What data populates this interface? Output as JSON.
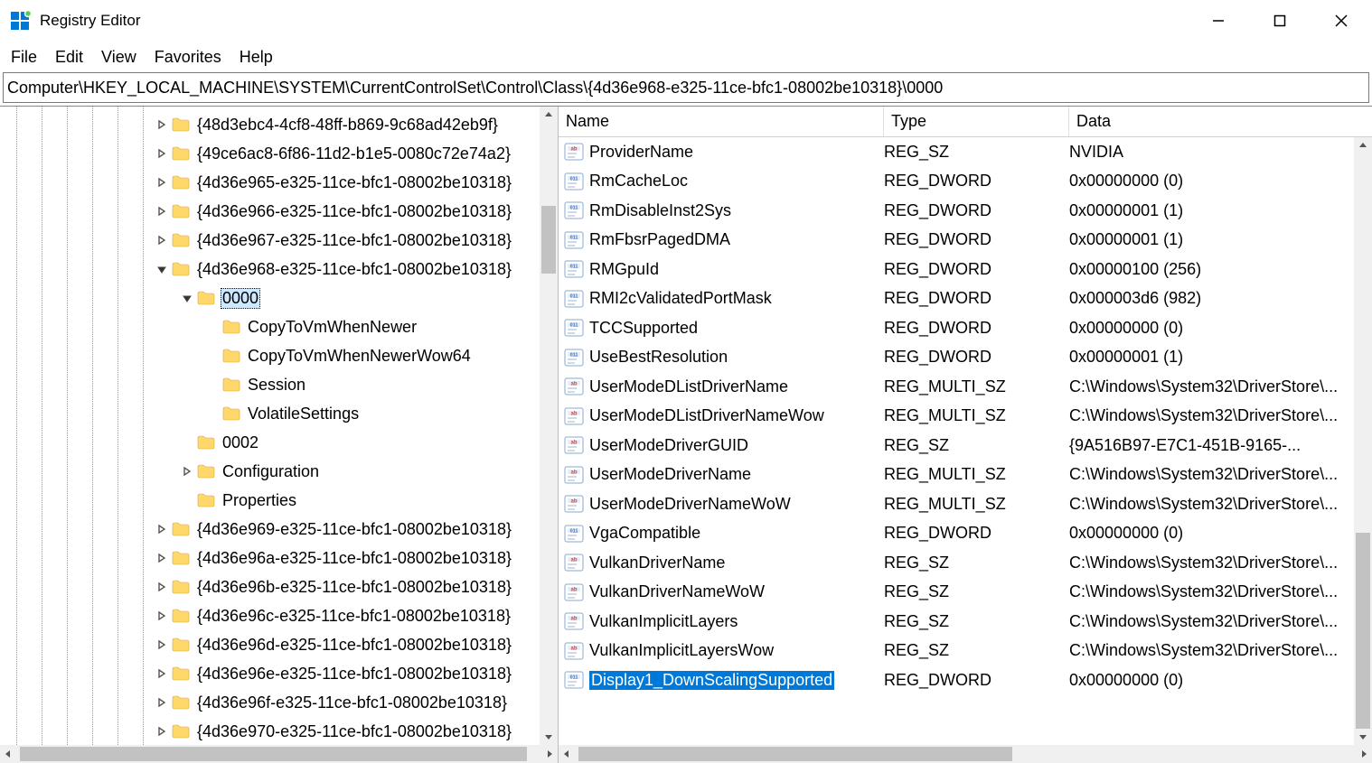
{
  "window": {
    "title": "Registry Editor"
  },
  "menu": {
    "items": [
      "File",
      "Edit",
      "View",
      "Favorites",
      "Help"
    ]
  },
  "address": "Computer\\HKEY_LOCAL_MACHINE\\SYSTEM\\CurrentControlSet\\Control\\Class\\{4d36e968-e325-11ce-bfc1-08002be10318}\\0000",
  "tree": {
    "rows": [
      {
        "level": 6,
        "expander": "closed",
        "label": "{48d3ebc4-4cf8-48ff-b869-9c68ad42eb9f}"
      },
      {
        "level": 6,
        "expander": "closed",
        "label": "{49ce6ac8-6f86-11d2-b1e5-0080c72e74a2}"
      },
      {
        "level": 6,
        "expander": "closed",
        "label": "{4d36e965-e325-11ce-bfc1-08002be10318}"
      },
      {
        "level": 6,
        "expander": "closed",
        "label": "{4d36e966-e325-11ce-bfc1-08002be10318}"
      },
      {
        "level": 6,
        "expander": "closed",
        "label": "{4d36e967-e325-11ce-bfc1-08002be10318}"
      },
      {
        "level": 6,
        "expander": "open",
        "label": "{4d36e968-e325-11ce-bfc1-08002be10318}"
      },
      {
        "level": 7,
        "expander": "open",
        "label": "0000",
        "selected": true
      },
      {
        "level": 8,
        "expander": "none",
        "label": "CopyToVmWhenNewer"
      },
      {
        "level": 8,
        "expander": "none",
        "label": "CopyToVmWhenNewerWow64"
      },
      {
        "level": 8,
        "expander": "none",
        "label": "Session"
      },
      {
        "level": 8,
        "expander": "none",
        "label": "VolatileSettings"
      },
      {
        "level": 7,
        "expander": "none",
        "label": "0002"
      },
      {
        "level": 7,
        "expander": "closed",
        "label": "Configuration"
      },
      {
        "level": 7,
        "expander": "none",
        "label": "Properties"
      },
      {
        "level": 6,
        "expander": "closed",
        "label": "{4d36e969-e325-11ce-bfc1-08002be10318}"
      },
      {
        "level": 6,
        "expander": "closed",
        "label": "{4d36e96a-e325-11ce-bfc1-08002be10318}"
      },
      {
        "level": 6,
        "expander": "closed",
        "label": "{4d36e96b-e325-11ce-bfc1-08002be10318}"
      },
      {
        "level": 6,
        "expander": "closed",
        "label": "{4d36e96c-e325-11ce-bfc1-08002be10318}"
      },
      {
        "level": 6,
        "expander": "closed",
        "label": "{4d36e96d-e325-11ce-bfc1-08002be10318}"
      },
      {
        "level": 6,
        "expander": "closed",
        "label": "{4d36e96e-e325-11ce-bfc1-08002be10318}"
      },
      {
        "level": 6,
        "expander": "closed",
        "label": "{4d36e96f-e325-11ce-bfc1-08002be10318}"
      },
      {
        "level": 6,
        "expander": "closed",
        "label": "{4d36e970-e325-11ce-bfc1-08002be10318}"
      }
    ]
  },
  "list": {
    "columns": {
      "name": "Name",
      "type": "Type",
      "data": "Data"
    },
    "rows": [
      {
        "icon": "str",
        "name": "ProviderName",
        "type": "REG_SZ",
        "data": "NVIDIA"
      },
      {
        "icon": "bin",
        "name": "RmCacheLoc",
        "type": "REG_DWORD",
        "data": "0x00000000 (0)"
      },
      {
        "icon": "bin",
        "name": "RmDisableInst2Sys",
        "type": "REG_DWORD",
        "data": "0x00000001 (1)"
      },
      {
        "icon": "bin",
        "name": "RmFbsrPagedDMA",
        "type": "REG_DWORD",
        "data": "0x00000001 (1)"
      },
      {
        "icon": "bin",
        "name": "RMGpuId",
        "type": "REG_DWORD",
        "data": "0x00000100 (256)"
      },
      {
        "icon": "bin",
        "name": "RMI2cValidatedPortMask",
        "type": "REG_DWORD",
        "data": "0x000003d6 (982)"
      },
      {
        "icon": "bin",
        "name": "TCCSupported",
        "type": "REG_DWORD",
        "data": "0x00000000 (0)"
      },
      {
        "icon": "bin",
        "name": "UseBestResolution",
        "type": "REG_DWORD",
        "data": "0x00000001 (1)"
      },
      {
        "icon": "str",
        "name": "UserModeDListDriverName",
        "type": "REG_MULTI_SZ",
        "data": "C:\\Windows\\System32\\DriverStore\\..."
      },
      {
        "icon": "str",
        "name": "UserModeDListDriverNameWow",
        "type": "REG_MULTI_SZ",
        "data": "C:\\Windows\\System32\\DriverStore\\..."
      },
      {
        "icon": "str",
        "name": "UserModeDriverGUID",
        "type": "REG_SZ",
        "data": "{9A516B97-E7C1-451B-9165-..."
      },
      {
        "icon": "str",
        "name": "UserModeDriverName",
        "type": "REG_MULTI_SZ",
        "data": "C:\\Windows\\System32\\DriverStore\\..."
      },
      {
        "icon": "str",
        "name": "UserModeDriverNameWoW",
        "type": "REG_MULTI_SZ",
        "data": "C:\\Windows\\System32\\DriverStore\\..."
      },
      {
        "icon": "bin",
        "name": "VgaCompatible",
        "type": "REG_DWORD",
        "data": "0x00000000 (0)"
      },
      {
        "icon": "str",
        "name": "VulkanDriverName",
        "type": "REG_SZ",
        "data": "C:\\Windows\\System32\\DriverStore\\..."
      },
      {
        "icon": "str",
        "name": "VulkanDriverNameWoW",
        "type": "REG_SZ",
        "data": "C:\\Windows\\System32\\DriverStore\\..."
      },
      {
        "icon": "str",
        "name": "VulkanImplicitLayers",
        "type": "REG_SZ",
        "data": "C:\\Windows\\System32\\DriverStore\\..."
      },
      {
        "icon": "str",
        "name": "VulkanImplicitLayersWow",
        "type": "REG_SZ",
        "data": "C:\\Windows\\System32\\DriverStore\\..."
      },
      {
        "icon": "bin",
        "name": "Display1_DownScalingSupported",
        "type": "REG_DWORD",
        "data": "0x00000000 (0)",
        "selected": true
      }
    ]
  }
}
